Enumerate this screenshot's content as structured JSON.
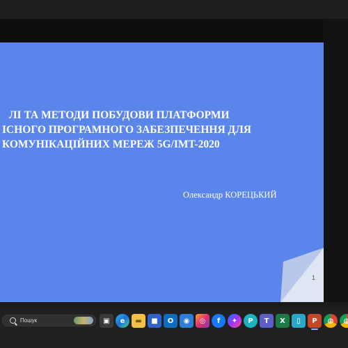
{
  "slide": {
    "title_lines": [
      "ЛІ ТА МЕТОДИ ПОБУДОВИ ПЛАТФОРМИ",
      "ІСНОГО ПРОГРАМНОГО ЗАБЕЗПЕЧЕННЯ ДЛЯ",
      "КОМУНІКАЦІЙНИХ МЕРЕЖ 5G/IMT-2020"
    ],
    "author": "Олександр КОРЕЦЬКИЙ",
    "page_number": "1",
    "background_color": "#5a85ea"
  },
  "taskbar": {
    "search_label": "Пошук",
    "apps": [
      {
        "name": "task-view-icon",
        "glyph": "▣"
      },
      {
        "name": "edge-icon",
        "glyph": "e"
      },
      {
        "name": "file-explorer-icon",
        "glyph": "▬"
      },
      {
        "name": "store-icon",
        "glyph": "■"
      },
      {
        "name": "outlook-icon",
        "glyph": "O"
      },
      {
        "name": "photos-icon",
        "glyph": "◉"
      },
      {
        "name": "instagram-icon",
        "glyph": "◎"
      },
      {
        "name": "facebook-icon",
        "glyph": "f"
      },
      {
        "name": "messenger-icon",
        "glyph": "✦"
      },
      {
        "name": "picsart-icon",
        "glyph": "P"
      },
      {
        "name": "teams-icon",
        "glyph": "T"
      },
      {
        "name": "excel-icon",
        "glyph": "X"
      },
      {
        "name": "tablet-icon",
        "glyph": "▯"
      },
      {
        "name": "powerpoint-icon",
        "glyph": "P"
      },
      {
        "name": "chrome-icon",
        "glyph": "◍"
      },
      {
        "name": "chrome-profile-icon",
        "glyph": "◍"
      }
    ]
  }
}
